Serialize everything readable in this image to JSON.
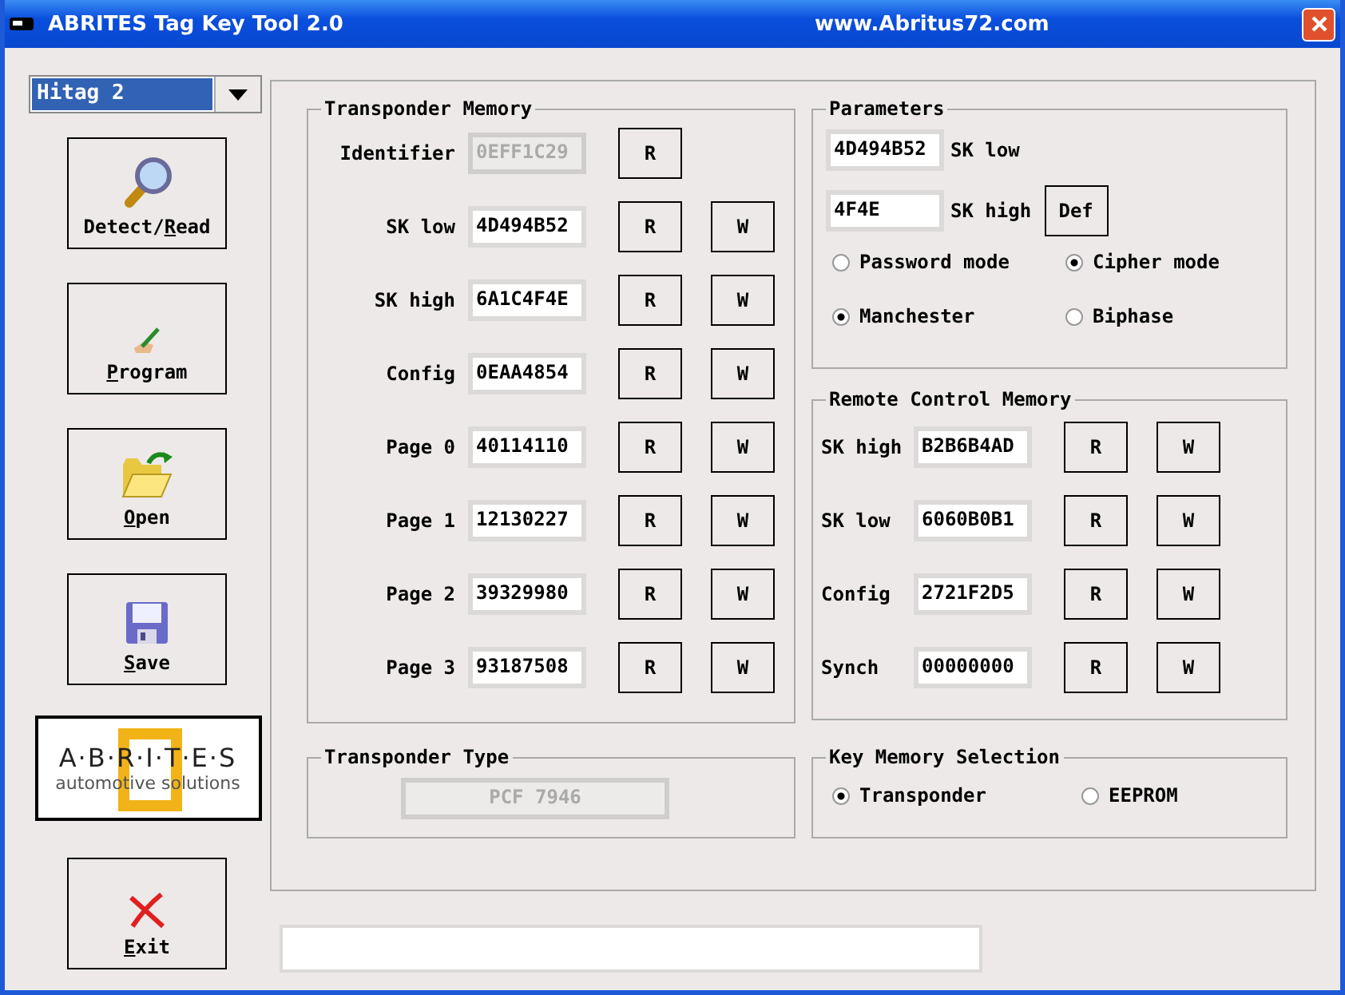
{
  "window": {
    "title": "ABRITES Tag Key Tool 2.0",
    "url": "www.Abritus72.com"
  },
  "tag_select": {
    "value": "Hitag 2"
  },
  "actions": [
    {
      "kind": "detect",
      "pre": "Detect/",
      "key": "R",
      "post": "ead"
    },
    {
      "kind": "program",
      "key": "P",
      "post": "rogram"
    },
    {
      "kind": "open",
      "key": "O",
      "post": "pen"
    },
    {
      "kind": "save",
      "key": "S",
      "post": "ave"
    }
  ],
  "logo": {
    "wordmark": "A·B·R·I·T·E·S",
    "tagline": "automotive solutions"
  },
  "exit": {
    "kind": "exit",
    "key": "E",
    "post": "xit"
  },
  "transponder_memory": {
    "title": "Transponder Memory",
    "rows": [
      {
        "label": "Identifier",
        "value": "0EFF1C29",
        "disabled": true,
        "read": "R"
      },
      {
        "label": "SK low",
        "value": "4D494B52",
        "disabled": false,
        "read": "R",
        "write": "W"
      },
      {
        "label": "SK high",
        "value": "6A1C4F4E",
        "disabled": false,
        "read": "R",
        "write": "W"
      },
      {
        "label": "Config",
        "value": "0EAA4854",
        "disabled": false,
        "read": "R",
        "write": "W"
      },
      {
        "label": "Page 0",
        "value": "40114110",
        "disabled": false,
        "read": "R",
        "write": "W"
      },
      {
        "label": "Page 1",
        "value": "12130227",
        "disabled": false,
        "read": "R",
        "write": "W"
      },
      {
        "label": "Page 2",
        "value": "39329980",
        "disabled": false,
        "read": "R",
        "write": "W"
      },
      {
        "label": "Page 3",
        "value": "93187508",
        "disabled": false,
        "read": "R",
        "write": "W"
      }
    ]
  },
  "parameters": {
    "title": "Parameters",
    "sk_low": {
      "value": "4D494B52",
      "label": "SK low"
    },
    "sk_high": {
      "value": "4F4E",
      "label": "SK high",
      "button": "Def"
    },
    "mode": [
      {
        "label": "Password mode",
        "selected": false
      },
      {
        "label": "Cipher mode",
        "selected": true
      }
    ],
    "encoding": [
      {
        "label": "Manchester",
        "selected": true
      },
      {
        "label": "Biphase",
        "selected": false
      }
    ]
  },
  "remote_control_memory": {
    "title": "Remote Control Memory",
    "rows": [
      {
        "label": "SK high",
        "value": "B2B6B4AD",
        "read": "R",
        "write": "W"
      },
      {
        "label": "SK low",
        "value": "6060B0B1",
        "read": "R",
        "write": "W"
      },
      {
        "label": "Config",
        "value": "2721F2D5",
        "read": "R",
        "write": "W"
      },
      {
        "label": "Synch",
        "value": "00000000",
        "read": "R",
        "write": "W"
      }
    ]
  },
  "transponder_type": {
    "title": "Transponder Type",
    "value": "PCF 7946",
    "disabled": true
  },
  "key_memory_selection": {
    "title": "Key Memory Selection",
    "options": [
      {
        "label": "Transponder",
        "selected": true
      },
      {
        "label": "EEPROM",
        "selected": false
      }
    ]
  }
}
